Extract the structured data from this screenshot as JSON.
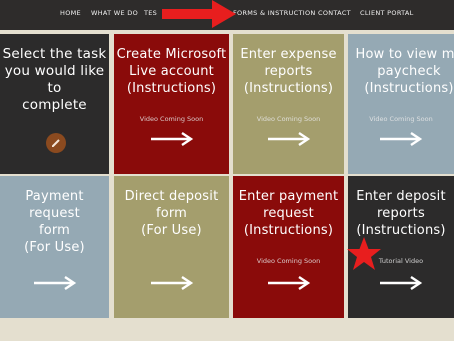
{
  "nav": {
    "items": [
      {
        "label": "HOME"
      },
      {
        "label": "WHAT WE DO"
      },
      {
        "label": "TES"
      },
      {
        "label": "FORMS & INSTRUCTION"
      },
      {
        "label": "CONTACT"
      },
      {
        "label": "CLIENT PORTAL"
      }
    ]
  },
  "tiles": [
    {
      "title": "Select the task\nyou would like to\ncomplete",
      "sub": "",
      "color": "#2c2b2b"
    },
    {
      "title": "Create Microsoft\nLive account\n(Instructions)",
      "sub": "Video Coming Soon",
      "color": "#8a0b0a"
    },
    {
      "title": "Enter expense\nreports\n(Instructions)",
      "sub": "Video Coming Soon",
      "color": "#a49e6d"
    },
    {
      "title": "How to view my\npaycheck\n(Instructions)",
      "sub": "Video Coming Soon",
      "color": "#95a9b4"
    },
    {
      "title": "Payment request\nform\n(For Use)",
      "sub": "",
      "color": "#95a9b4"
    },
    {
      "title": "Direct deposit\nform\n(For Use)",
      "sub": "",
      "color": "#a49e6d"
    },
    {
      "title": "Enter payment\nrequest\n(Instructions)",
      "sub": "Video Coming Soon",
      "color": "#8a0b0a"
    },
    {
      "title": "Enter deposit\nreports\n(Instructions)",
      "sub": "Tutorial Video",
      "color": "#2c2b2b"
    }
  ],
  "colors": {
    "annotation_red": "#e81e1e",
    "nav_bg": "#2e2c2b",
    "page_bg": "#e4dfcf"
  },
  "icons": {
    "pencil": "pencil-icon",
    "arrow": "right-arrow-icon"
  }
}
